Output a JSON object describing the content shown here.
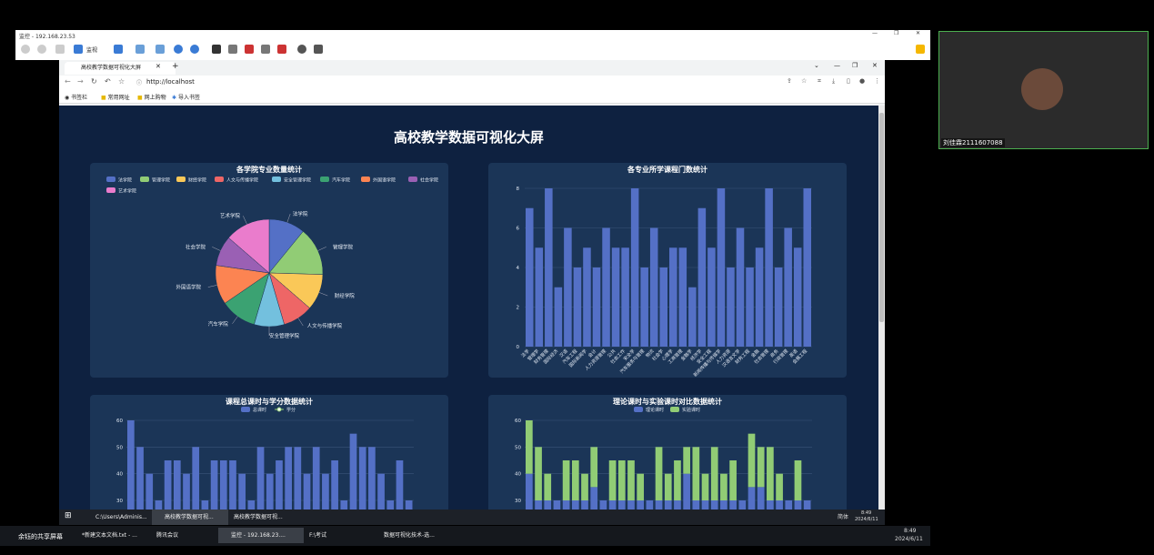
{
  "remote": {
    "title": "监控 - 192.168.23.53",
    "toolbar_label": "监视"
  },
  "browser": {
    "tab_title": "高校教学数据可视化大屏",
    "url": "http://localhost",
    "bookmarks": [
      "书签栏",
      "常用网址",
      "网上购物",
      "导入书签"
    ]
  },
  "dashboard": {
    "title": "高校教学数据可视化大屏",
    "colors": {
      "bg": "#0e2140",
      "panel": "#1b3557",
      "palette": [
        "#5470c6",
        "#91cc75",
        "#fac858",
        "#ee6666",
        "#73c0de",
        "#3ba272",
        "#fc8452",
        "#9a60b4",
        "#ea7ccc"
      ]
    },
    "pie": {
      "title": "各学院专业数量统计",
      "legend": [
        "法学院",
        "管理学院",
        "财经学院",
        "人文与传播学院",
        "安全管理学院",
        "汽车学院",
        "外国语学院",
        "社会学院",
        "艺术学院"
      ],
      "labels": [
        "法学院",
        "管理学院",
        "财经学院",
        "人文与传播学院",
        "安全管理学院",
        "汽车学院",
        "外国语学院",
        "社会学院",
        "艺术学院"
      ]
    },
    "bar_courses": {
      "title": "各专业所学课程门数统计",
      "y_ticks": [
        "0",
        "2",
        "4",
        "6",
        "8"
      ]
    },
    "hours_credits": {
      "title": "课程总课时与学分数据统计",
      "legend": [
        "总课时",
        "学分"
      ],
      "y_ticks": [
        "30",
        "40",
        "50",
        "60"
      ]
    },
    "theory_practice": {
      "title": "理论课时与实验课时对比数据统计",
      "legend": [
        "理论课时",
        "实验课时"
      ],
      "y_ticks": [
        "30",
        "40",
        "50",
        "60"
      ]
    }
  },
  "chart_data": [
    {
      "type": "pie",
      "title": "各学院专业数量统计",
      "labels": [
        "法学院",
        "管理学院",
        "财经学院",
        "人文与传播学院",
        "安全管理学院",
        "汽车学院",
        "外国语学院",
        "社会学院",
        "艺术学院"
      ],
      "values": [
        12,
        16,
        12,
        10,
        10,
        12,
        13,
        10,
        15
      ]
    },
    {
      "type": "bar",
      "title": "各专业所学课程门数统计",
      "x_labels": [
        "法学",
        "管理学",
        "财务管理",
        "国际经济",
        "汉语",
        "汽车工程",
        "国际新闻学",
        "会计",
        "人力资源管理",
        "公共",
        "社会工作",
        "安全学",
        "汽车服务与管理",
        "物流",
        "社会学",
        "心理学",
        "工商管理",
        "金融学",
        "经济学",
        "安全工程",
        "新闻传播与传媒学",
        "人力资源",
        "汉语言文学",
        "财务工程",
        "金融",
        "社会管理",
        "商务",
        "行政管理",
        "英语",
        "会展工程"
      ],
      "values": [
        7,
        5,
        8,
        3,
        6,
        4,
        5,
        4,
        6,
        5,
        5,
        8,
        4,
        6,
        4,
        5,
        5,
        3,
        7,
        5,
        8,
        4,
        6,
        4,
        5,
        8,
        4,
        6,
        5,
        8
      ],
      "ylim": [
        0,
        8
      ]
    },
    {
      "type": "bar",
      "title": "课程总课时与学分数据统计",
      "series": [
        {
          "name": "总课时",
          "values": [
            60,
            50,
            40,
            30,
            45,
            45,
            40,
            50,
            30,
            45,
            45,
            45,
            40,
            30,
            50,
            40,
            45,
            50,
            50,
            40,
            50,
            40,
            45,
            30,
            55,
            50,
            50,
            40,
            30,
            45,
            30
          ]
        },
        {
          "name": "学分",
          "values": []
        }
      ],
      "ylim": [
        30,
        60
      ]
    },
    {
      "type": "bar",
      "title": "理论课时与实验课时对比数据统计",
      "series": [
        {
          "name": "理论课时",
          "values": [
            40,
            30,
            30,
            30,
            30,
            30,
            30,
            35,
            30,
            30,
            30,
            30,
            30,
            30,
            30,
            30,
            30,
            40,
            30,
            30,
            30,
            30,
            30,
            30,
            35,
            35,
            30,
            30,
            30,
            30,
            30
          ]
        },
        {
          "name": "实验课时",
          "values": [
            20,
            20,
            10,
            0,
            15,
            15,
            10,
            15,
            0,
            15,
            15,
            15,
            10,
            0,
            20,
            10,
            15,
            10,
            20,
            10,
            20,
            10,
            15,
            0,
            20,
            15,
            20,
            10,
            0,
            15,
            0
          ]
        }
      ],
      "ylim": [
        30,
        60
      ]
    }
  ],
  "inner_taskbar": {
    "items": [
      "C:\\Users\\Adminis...",
      "高校教学数据可视...",
      "高校教学数据可视..."
    ],
    "lang": "简体",
    "time": "8:49",
    "date": "2024/6/11"
  },
  "outer_taskbar": {
    "share_label": "余钰的共享屏幕",
    "items": [
      "*新建文本文档.txt - ...",
      "腾讯会议",
      "监控 - 192.168.23....",
      "F:\\考试",
      "数据可视化技术-选..."
    ],
    "time": "8:49",
    "date": "2024/6/11"
  },
  "video": {
    "participant": "刘佳霖2111607088"
  }
}
